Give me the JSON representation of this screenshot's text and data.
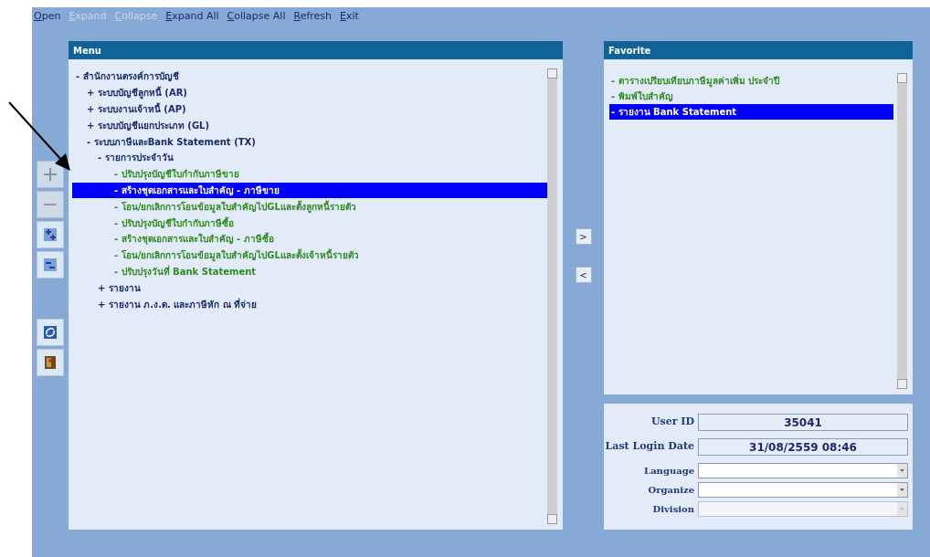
{
  "menu_bar": [
    {
      "label": "Open",
      "disabled": false
    },
    {
      "label": "Expand",
      "disabled": true
    },
    {
      "label": "Collapse",
      "disabled": true
    },
    {
      "label": "Expand All",
      "disabled": false
    },
    {
      "label": "Collapse All",
      "disabled": false
    },
    {
      "label": "Refresh",
      "disabled": false
    },
    {
      "label": "Exit",
      "disabled": false
    }
  ],
  "toolbar": [
    {
      "kind": "expand",
      "disabled": true
    },
    {
      "kind": "collapse",
      "disabled": true
    },
    {
      "kind": "expand-all",
      "disabled": false
    },
    {
      "kind": "collapse-all",
      "disabled": false
    },
    {
      "kind": "refresh",
      "disabled": false
    },
    {
      "kind": "exit",
      "disabled": false
    }
  ],
  "menu": {
    "title": "Menu",
    "items": [
      {
        "kind": "group",
        "marker": "-",
        "label": "สำนักงานตรงค์การบัญชี",
        "selected": false,
        "children": [
          {
            "kind": "group",
            "marker": "+",
            "label": "ระบบบัญชีลูกหนี้ (AR)",
            "selected": false
          },
          {
            "kind": "group",
            "marker": "+",
            "label": "ระบบงานเจ้าหนี้ (AP)",
            "selected": false
          },
          {
            "kind": "group",
            "marker": "+",
            "label": "ระบบบัญชีแยกประเภท (GL)",
            "selected": false
          },
          {
            "kind": "group",
            "marker": "-",
            "label": "ระบบภาษีและBank Statement (TX)",
            "selected": false,
            "children": [
              {
                "kind": "group",
                "marker": "-",
                "label": "รายการประจำวัน",
                "selected": false,
                "children": [
                  {
                    "kind": "leaf",
                    "marker": "-",
                    "label": "ปรับปรุงบัญชีใบกำกับภาษีขาย",
                    "selected": false
                  },
                  {
                    "kind": "leaf",
                    "marker": "-",
                    "label": "สร้างชุดเอกสารและใบสำคัญ - ภาษีขาย",
                    "selected": true
                  },
                  {
                    "kind": "leaf",
                    "marker": "-",
                    "label": "โอน/ยกเลิกการโอนข้อมูลใบสำคัญไปGLและตั้งลูกหนี้รายตัว",
                    "selected": false
                  },
                  {
                    "kind": "leaf",
                    "marker": "-",
                    "label": "ปรับปรุงบัญชีใบกำกับภาษีซื้อ",
                    "selected": false
                  },
                  {
                    "kind": "leaf",
                    "marker": "-",
                    "label": "สร้างชุดเอกสารและใบสำคัญ - ภาษีซื้อ",
                    "selected": false
                  },
                  {
                    "kind": "leaf",
                    "marker": "-",
                    "label": "โอน/ยกเลิกการโอนข้อมูลใบสำคัญไปGLและตั้งเจ้าหนี้รายตัว",
                    "selected": false
                  },
                  {
                    "kind": "leaf",
                    "marker": "-",
                    "label": "ปรับปรุงวันที่ Bank Statement",
                    "selected": false
                  }
                ]
              },
              {
                "kind": "group",
                "marker": "+",
                "label": "รายงาน",
                "selected": false
              },
              {
                "kind": "group",
                "marker": "+",
                "label": "รายงาน ภ.ง.ด. และภาษีหัก ณ ที่จ่าย",
                "selected": false
              }
            ]
          }
        ]
      }
    ]
  },
  "transfer_buttons": [
    ">",
    "<"
  ],
  "favorite": {
    "title": "Favorite",
    "items": [
      {
        "label": "- ตารางเปรียบเทียบภาษีมูลค่าเพิ่ม ประจำปี",
        "selected": false
      },
      {
        "label": "- พิมพ์ใบสำคัญ",
        "selected": false
      },
      {
        "label": "- รายงาน Bank Statement",
        "selected": true
      }
    ]
  },
  "user_info": [
    {
      "kind": "display",
      "label": "User ID",
      "value": "35041"
    },
    {
      "kind": "display",
      "label": "Last Login Date",
      "value": "31/08/2559 08:46"
    },
    {
      "kind": "select",
      "label": "Language",
      "disabled": false
    },
    {
      "kind": "select",
      "label": "Organize",
      "disabled": false
    },
    {
      "kind": "select",
      "label": "Division",
      "disabled": true
    }
  ]
}
